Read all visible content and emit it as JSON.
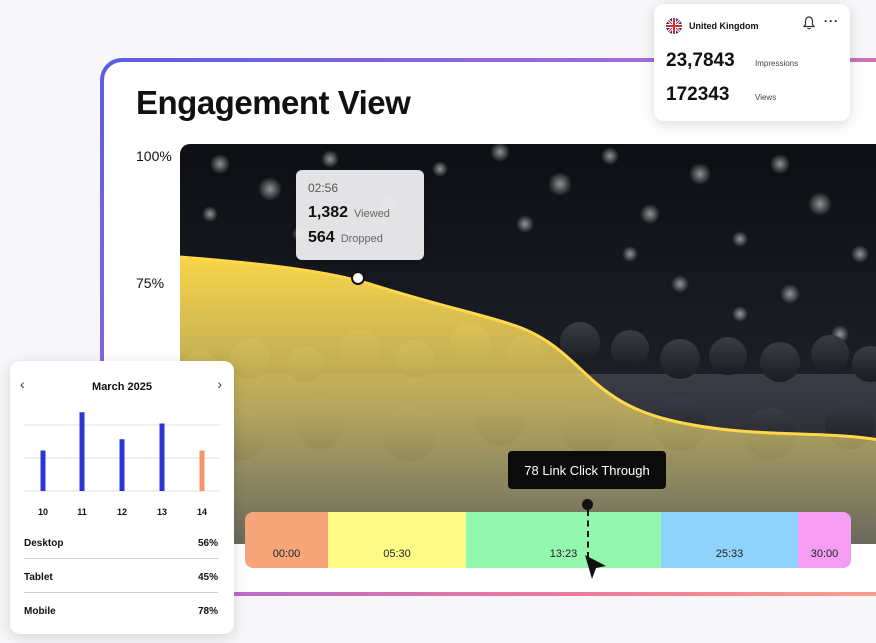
{
  "header": {
    "title": "Engagement View"
  },
  "axis": {
    "y_top": "100%",
    "y_mid": "75%"
  },
  "tooltip": {
    "time": "02:56",
    "viewed_value": "1,382",
    "viewed_label": "Viewed",
    "dropped_value": "564",
    "dropped_label": "Dropped"
  },
  "timeline": {
    "callout": "78 Link Click Through",
    "segments": [
      {
        "label": "00:00",
        "color": "#f7a67c"
      },
      {
        "label": "05:30",
        "color": "#fdfb85"
      },
      {
        "label": "13:23",
        "color": "#93f7ae"
      },
      {
        "label": "25:33",
        "color": "#8fd2fb"
      },
      {
        "label": "30:00",
        "color": "#f59cf3"
      }
    ]
  },
  "region_card": {
    "country": "United Kingdom",
    "impressions_value": "23,7843",
    "impressions_label": "Impressions",
    "views_value": "172343",
    "views_label": "Views"
  },
  "calendar": {
    "month": "March 2025",
    "days": [
      "10",
      "11",
      "12",
      "13",
      "14"
    ],
    "devices": [
      {
        "name": "Desktop",
        "value": "56%"
      },
      {
        "name": "Tablet",
        "value": "45%"
      },
      {
        "name": "Mobile",
        "value": "78%"
      }
    ]
  },
  "chart_data": {
    "type": "bar",
    "categories": [
      "10",
      "11",
      "12",
      "13",
      "14"
    ],
    "values": [
      36,
      70,
      46,
      60,
      36
    ],
    "colors": [
      "#2b35d8",
      "#2b35d8",
      "#2b35d8",
      "#2b35d8",
      "#f69468"
    ],
    "ylim": [
      0,
      80
    ],
    "grid": true
  },
  "colors": {
    "accent_blue": "#2b35d8",
    "accent_orange": "#f69468",
    "engagement_yellow": "#ffd84a"
  }
}
